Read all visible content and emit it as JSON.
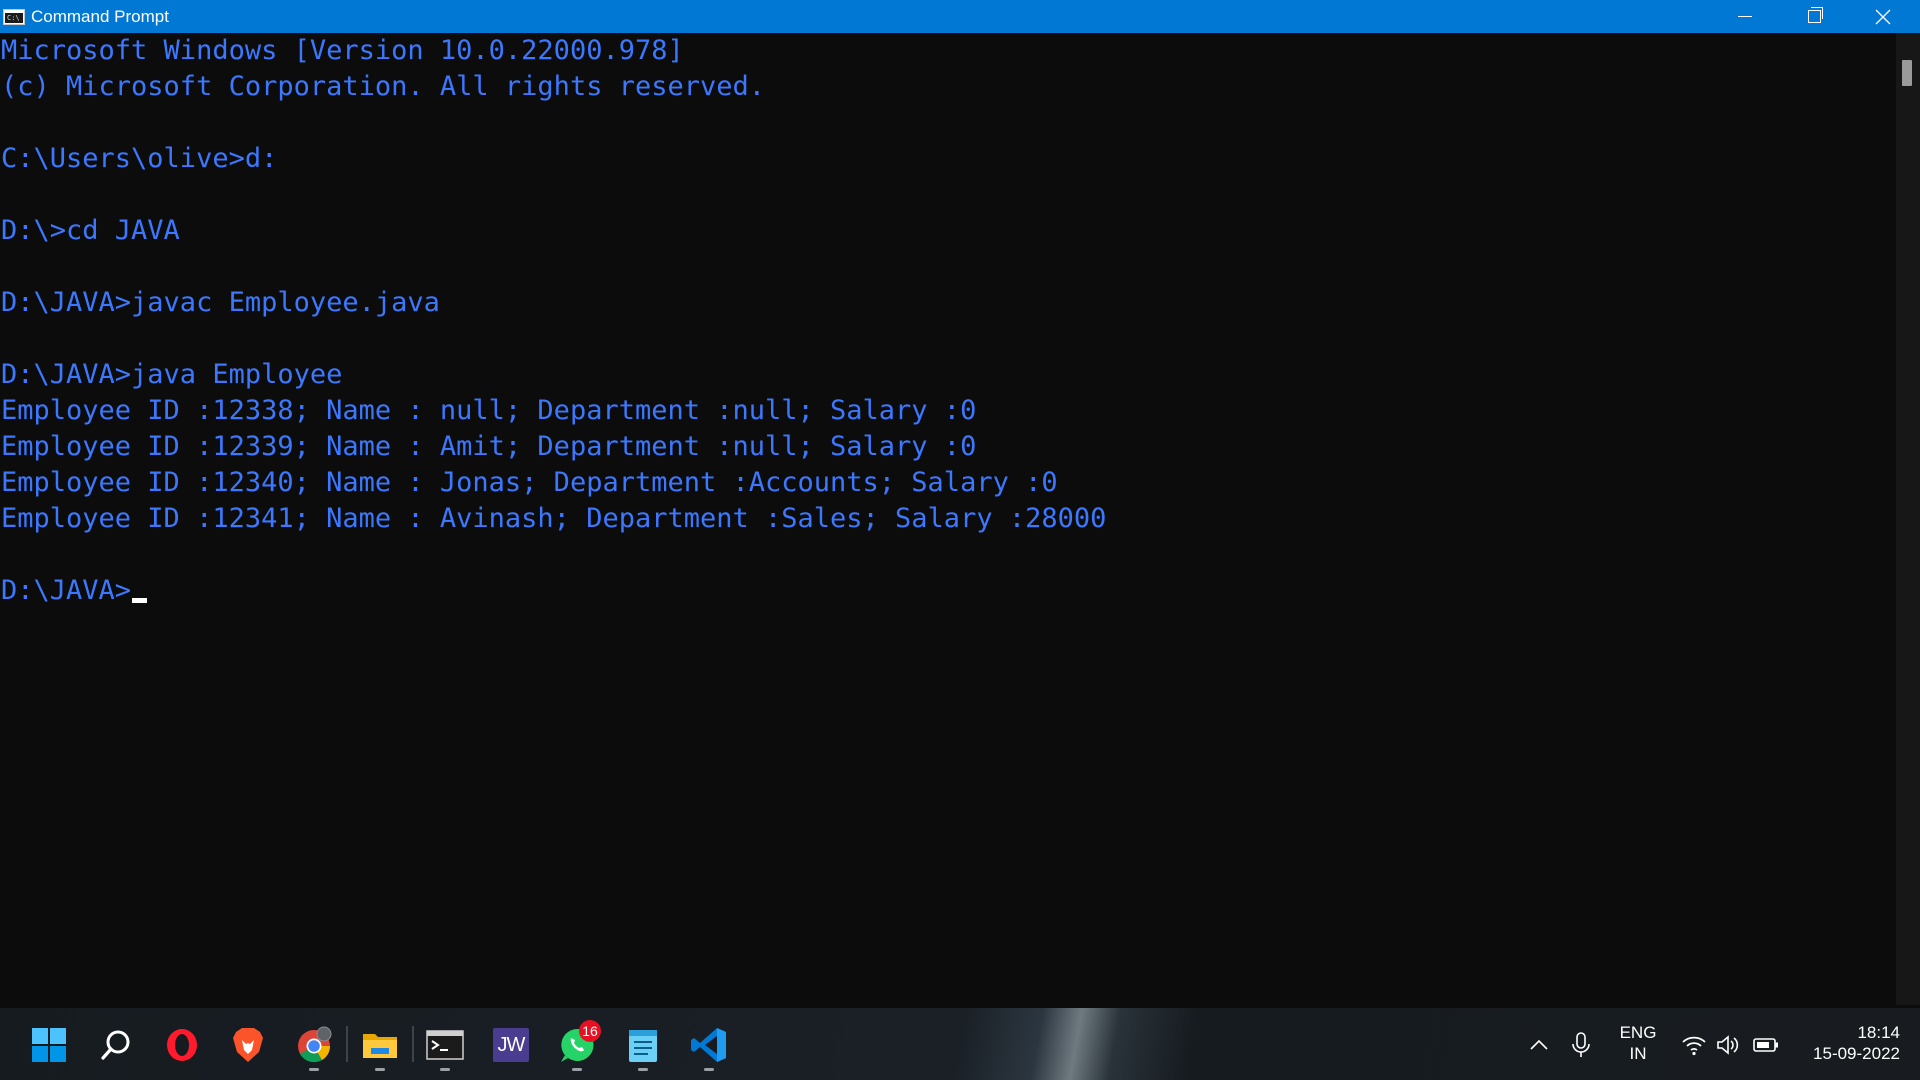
{
  "window": {
    "title": "Command Prompt"
  },
  "console": {
    "lines": [
      "Microsoft Windows [Version 10.0.22000.978]",
      "(c) Microsoft Corporation. All rights reserved.",
      "",
      "C:\\Users\\olive>d:",
      "",
      "D:\\>cd JAVA",
      "",
      "D:\\JAVA>javac Employee.java",
      "",
      "D:\\JAVA>java Employee",
      "Employee ID :12338; Name : null; Department :null; Salary :0",
      "Employee ID :12339; Name : Amit; Department :null; Salary :0",
      "Employee ID :12340; Name : Jonas; Department :Accounts; Salary :0",
      "Employee ID :12341; Name : Avinash; Department :Sales; Salary :28000",
      "",
      "D:\\JAVA>"
    ],
    "text_color": "#3b78ff",
    "background": "#0c0c0c"
  },
  "taskbar": {
    "apps": [
      {
        "name": "start",
        "icon": "windows-logo-icon"
      },
      {
        "name": "search",
        "icon": "search-icon"
      },
      {
        "name": "opera",
        "icon": "opera-icon"
      },
      {
        "name": "brave",
        "icon": "brave-icon"
      },
      {
        "name": "chrome",
        "icon": "chrome-icon"
      },
      {
        "name": "file-explorer",
        "icon": "folder-icon"
      },
      {
        "name": "command-prompt",
        "icon": "terminal-icon"
      },
      {
        "name": "jw",
        "icon": "jw-icon",
        "label": "JW"
      },
      {
        "name": "whatsapp",
        "icon": "whatsapp-icon",
        "badge": "16"
      },
      {
        "name": "notepad",
        "icon": "notepad-icon"
      },
      {
        "name": "vscode",
        "icon": "vscode-icon"
      }
    ],
    "tray": {
      "language_top": "ENG",
      "language_bottom": "IN",
      "time": "18:14",
      "date": "15-09-2022"
    }
  },
  "colors": {
    "titlebar": "#0078d4",
    "accent": "#3b78ff"
  }
}
